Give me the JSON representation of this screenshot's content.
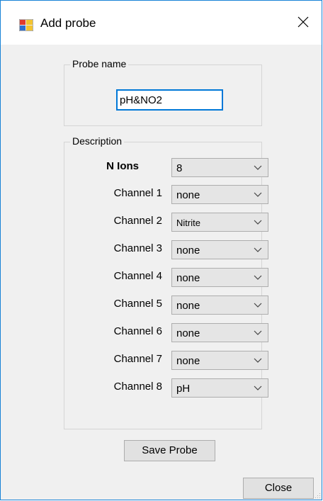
{
  "window": {
    "title": "Add probe",
    "accent_color": "#0078d7"
  },
  "icons": {
    "app": "app-window-icon",
    "close": "close-icon",
    "dropdown": "chevron-down-icon"
  },
  "probe_name": {
    "group_label": "Probe name",
    "value": "pH&NO2"
  },
  "description": {
    "group_label": "Description",
    "n_ions_label": "N Ions",
    "n_ions_value": "8",
    "channels": [
      {
        "label": "Channel 1",
        "value": "none"
      },
      {
        "label": "Channel 2",
        "value": "Nitrite"
      },
      {
        "label": "Channel 3",
        "value": "none"
      },
      {
        "label": "Channel 4",
        "value": "none"
      },
      {
        "label": "Channel 5",
        "value": "none"
      },
      {
        "label": "Channel 6",
        "value": "none"
      },
      {
        "label": "Channel 7",
        "value": "none"
      },
      {
        "label": "Channel 8",
        "value": "pH"
      }
    ]
  },
  "buttons": {
    "save": "Save Probe",
    "close": "Close"
  }
}
